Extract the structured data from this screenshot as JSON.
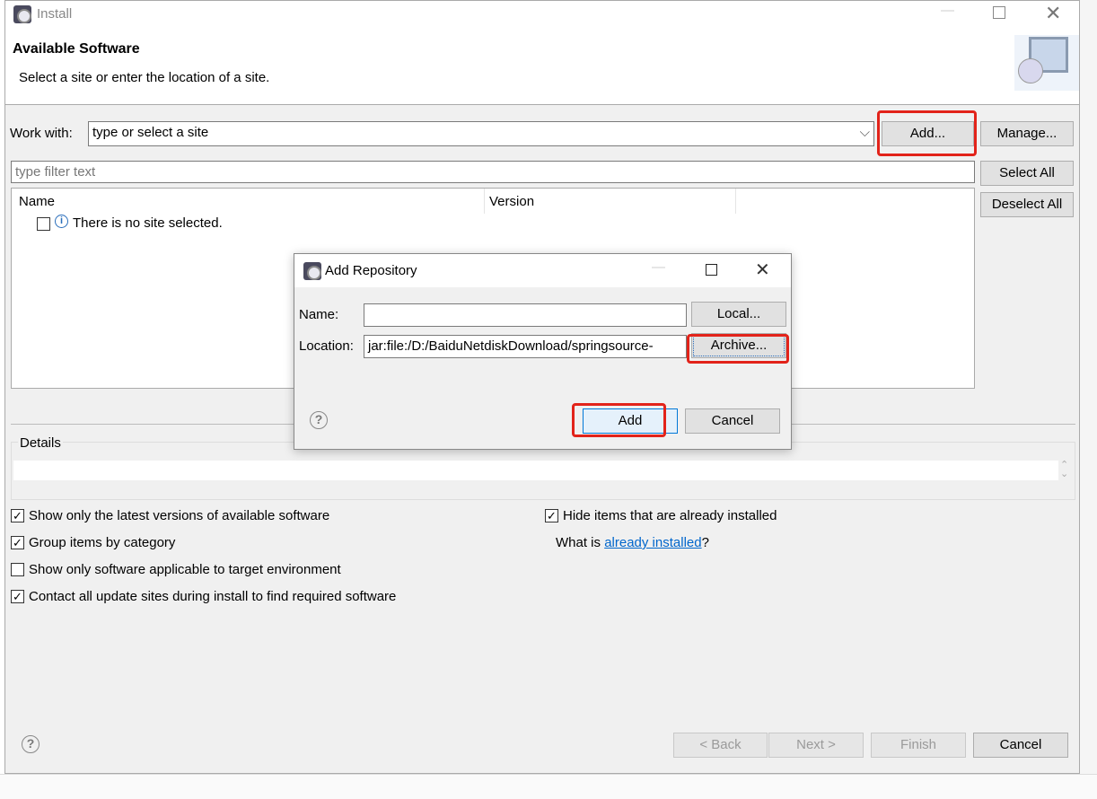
{
  "install": {
    "title": "Install",
    "heading": "Available Software",
    "subheading": "Select a site or enter the location of a site.",
    "work_with_label": "Work with:",
    "work_with_value": "type or select a site",
    "add_button": "Add...",
    "manage_button": "Manage...",
    "filter_placeholder": "type filter text",
    "select_all": "Select All",
    "deselect_all": "Deselect All",
    "columns": [
      "Name",
      "Version"
    ],
    "empty_row": "There is no site selected.",
    "details_label": "Details",
    "options": [
      {
        "label": "Show only the latest versions of available software",
        "checked": true
      },
      {
        "label": "Group items by category",
        "checked": true
      },
      {
        "label": "Show only software applicable to target environment",
        "checked": false
      },
      {
        "label": "Contact all update sites during install to find required software",
        "checked": true
      }
    ],
    "hide_installed": {
      "label": "Hide items that are already installed",
      "checked": true
    },
    "what_is_prefix": "What is ",
    "already_installed_link": "already installed",
    "what_is_suffix": "?",
    "back": "< Back",
    "next": "Next >",
    "finish": "Finish",
    "cancel": "Cancel"
  },
  "add_repo": {
    "title": "Add Repository",
    "name_label": "Name:",
    "name_value": "",
    "local_button": "Local...",
    "location_label": "Location:",
    "location_value": "jar:file:/D:/BaiduNetdiskDownload/springsource-",
    "archive_button": "Archive...",
    "add_button": "Add",
    "cancel_button": "Cancel"
  },
  "colors": {
    "highlight": "#e2231a",
    "link": "#0066cc"
  }
}
